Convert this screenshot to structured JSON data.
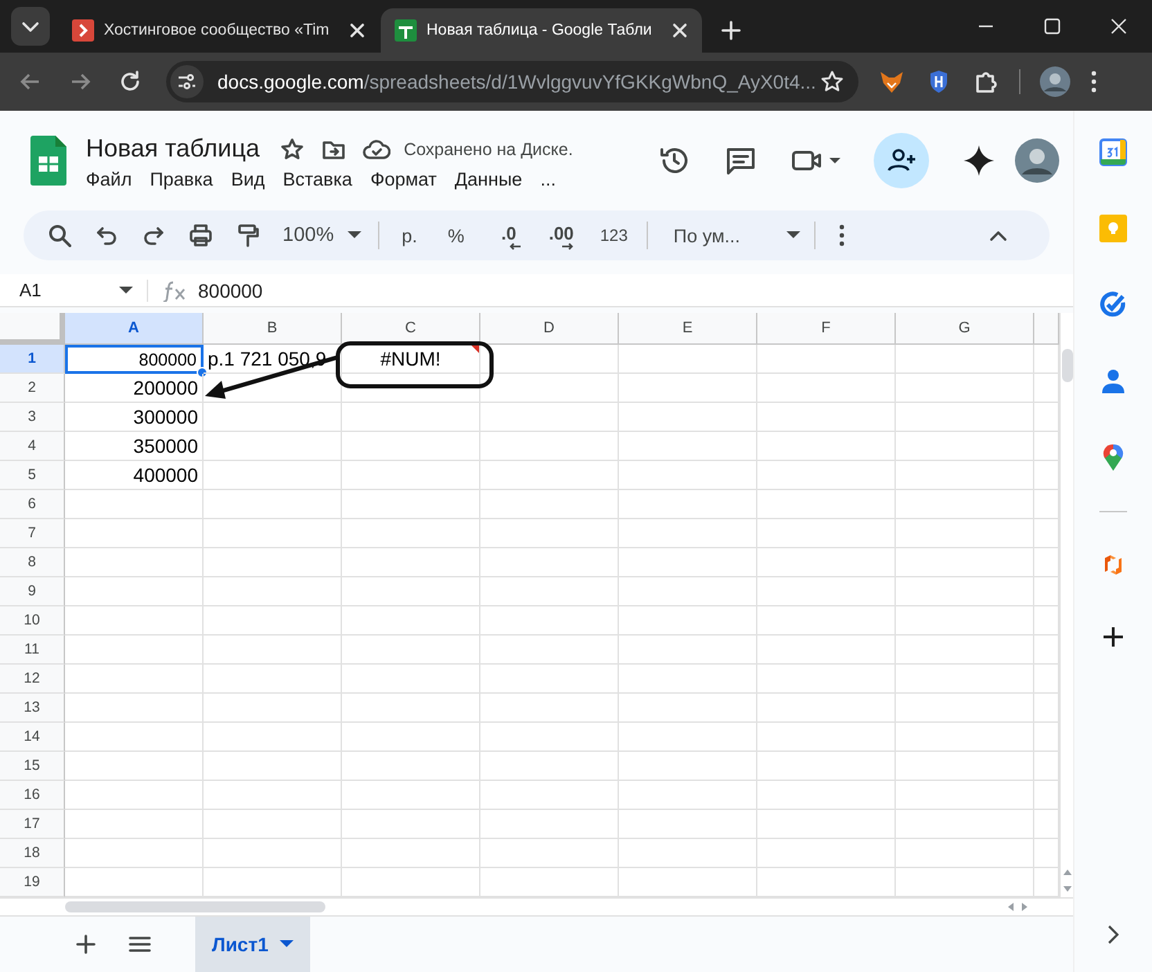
{
  "browser": {
    "tabs": [
      {
        "title": "Хостинговое сообщество «Tim",
        "selected": false
      },
      {
        "title": "Новая таблица - Google Табли",
        "selected": true
      }
    ],
    "url_host": "docs.google.com",
    "url_path": "/spreadsheets/d/1WvlggvuvYfGKKgWbnQ_AyX0t4..."
  },
  "document": {
    "title": "Новая таблица",
    "save_status": "Сохранено на Диске."
  },
  "menu": [
    "Файл",
    "Правка",
    "Вид",
    "Вставка",
    "Формат",
    "Данные",
    "..."
  ],
  "toolbar": {
    "zoom": "100%",
    "currency": "р.",
    "percent": "%",
    "decrease_decimals": ".0",
    "increase_decimals": ".00",
    "number_format": "123",
    "font": "По ум..."
  },
  "formula_bar": {
    "cell_ref": "A1",
    "formula": "800000"
  },
  "grid": {
    "columns": [
      {
        "label": "A",
        "selected": true
      },
      {
        "label": "B",
        "selected": false
      },
      {
        "label": "C",
        "selected": false
      },
      {
        "label": "D",
        "selected": false
      },
      {
        "label": "E",
        "selected": false
      },
      {
        "label": "F",
        "selected": false
      },
      {
        "label": "G",
        "selected": false
      }
    ],
    "rows": [
      {
        "label": "1",
        "selected": true,
        "cells": [
          {
            "value": "800000",
            "kind": "number",
            "selected": true
          },
          {
            "value": "р.1 721 050,9",
            "kind": "currency",
            "selected": false
          },
          {
            "value": "#NUM!",
            "kind": "error",
            "selected": false
          }
        ]
      },
      {
        "label": "2",
        "selected": false,
        "cells": [
          {
            "value": "200000",
            "kind": "number",
            "selected": false
          }
        ]
      },
      {
        "label": "3",
        "selected": false,
        "cells": [
          {
            "value": "300000",
            "kind": "number",
            "selected": false
          }
        ]
      },
      {
        "label": "4",
        "selected": false,
        "cells": [
          {
            "value": "350000",
            "kind": "number",
            "selected": false
          }
        ]
      },
      {
        "label": "5",
        "selected": false,
        "cells": [
          {
            "value": "400000",
            "kind": "number",
            "selected": false
          }
        ]
      },
      {
        "label": "6",
        "selected": false
      },
      {
        "label": "7",
        "selected": false
      },
      {
        "label": "8",
        "selected": false
      },
      {
        "label": "9",
        "selected": false
      },
      {
        "label": "10",
        "selected": false
      },
      {
        "label": "11",
        "selected": false
      },
      {
        "label": "12",
        "selected": false
      },
      {
        "label": "13",
        "selected": false
      },
      {
        "label": "14",
        "selected": false
      },
      {
        "label": "15",
        "selected": false
      },
      {
        "label": "16",
        "selected": false
      },
      {
        "label": "17",
        "selected": false
      },
      {
        "label": "18",
        "selected": false
      },
      {
        "label": "19",
        "selected": false
      }
    ]
  },
  "sheets": [
    {
      "label": "Лист1",
      "selected": true
    }
  ]
}
